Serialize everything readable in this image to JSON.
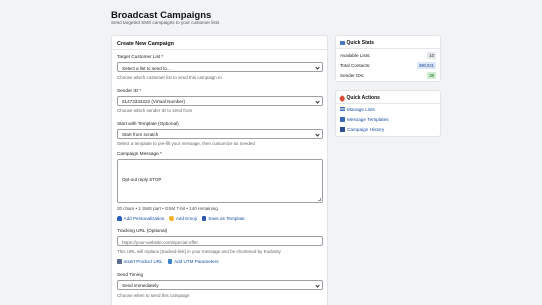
{
  "page": {
    "title": "Broadcast Campaigns",
    "subtitle": "Send targeted SMS campaigns to your customer lists"
  },
  "form": {
    "title": "Create New Campaign",
    "target_list": {
      "label": "Target Customer List *",
      "value": "Select a list to send to...",
      "help": "Choose which customer list to send this campaign to"
    },
    "sender_id": {
      "label": "Sender ID *",
      "value": "61473333222 (Virtual Number)",
      "help": "Choose which sender ID to send from"
    },
    "template": {
      "label": "Start with Template (Optional)",
      "value": "Start from scratch",
      "help": "Select a template to pre-fill your message, then customize as needed"
    },
    "message": {
      "label": "Campaign Message *",
      "value": "Opt-out reply STOP",
      "counter": "20 chars • 1 SMS part • GSM 7-bit • 140 remaining"
    },
    "message_actions": {
      "add_personalization": "Add Personalization",
      "add_emoji": "Add Emoji",
      "save_template": "Save as Template"
    },
    "tracking": {
      "label": "Tracking URL (Optional)",
      "placeholder": "https://your-website.com/special-offer",
      "help": "This URL will replace [tracked-link] in your message and be shortened by Kudosity"
    },
    "tracking_actions": {
      "insert_product": "Insert Product URL",
      "add_utm": "Add UTM Parameters"
    },
    "timing": {
      "label": "Send Timing",
      "value": "Send immediately",
      "help": "Choose when to send this campaign"
    }
  },
  "quick_stats": {
    "title": "Quick Stats",
    "rows": [
      {
        "label": "Available Lists:",
        "value": "10"
      },
      {
        "label": "Total Contacts:",
        "value": "390,021"
      },
      {
        "label": "Sender IDs:",
        "value": "38"
      }
    ]
  },
  "quick_actions": {
    "title": "Quick Actions",
    "items": [
      "Manage Lists",
      "Message Templates",
      "Campaign History"
    ]
  }
}
